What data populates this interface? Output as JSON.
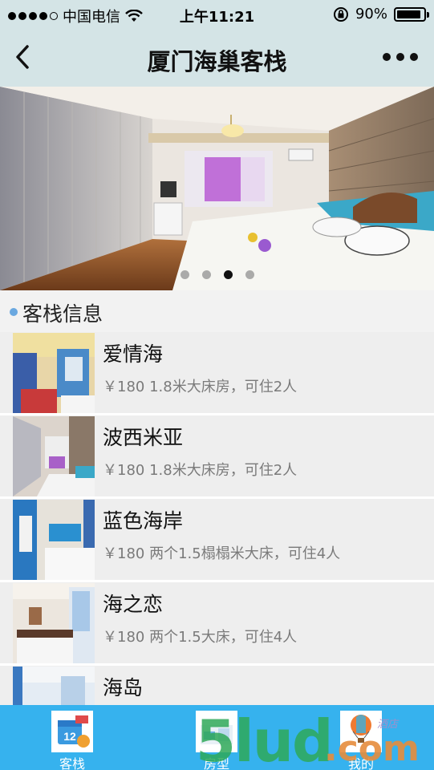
{
  "status_bar": {
    "carrier": "中国电信",
    "time": "上午11:21",
    "battery": "90%",
    "battery_level": 0.9
  },
  "nav": {
    "title": "厦门海巢客栈"
  },
  "banner": {
    "page_count": 4,
    "active_page": 3
  },
  "section": {
    "title": "客栈信息"
  },
  "rooms": [
    {
      "name": "爱情海",
      "desc": "￥180 1.8米大床房，可住2人"
    },
    {
      "name": "波西米亚",
      "desc": "￥180 1.8米大床房，可住2人"
    },
    {
      "name": "蓝色海岸",
      "desc": "￥180 两个1.5榻榻米大床，可住4人"
    },
    {
      "name": "海之恋",
      "desc": "￥180 两个1.5大床，可住4人"
    },
    {
      "name": "海岛",
      "desc": ""
    }
  ],
  "tabs": [
    {
      "label": "客栈",
      "icon": "calendar-icon"
    },
    {
      "label": "房型",
      "icon": "room-icon"
    },
    {
      "label": "我的",
      "icon": "balloon-icon"
    }
  ],
  "watermark": {
    "text": "5lud",
    "suffix": ".com",
    "small": "酒店"
  },
  "colors": {
    "header_bg": "#d4e4e6",
    "tabbar_bg": "#36b2ee",
    "section_dot": "#6aa8e0",
    "list_item_bg": "#eeeeee",
    "secondary_text": "#7a7a7a"
  }
}
